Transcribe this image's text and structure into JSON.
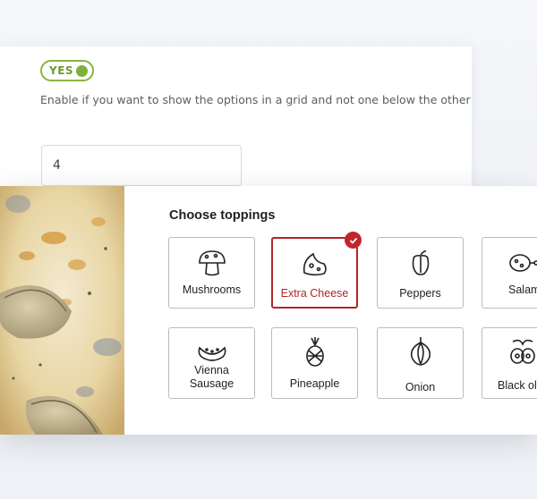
{
  "settings": {
    "toggle_label": "YES",
    "help_text": "Enable if you want to show the options in a grid and not one below the other",
    "columns_value": "4"
  },
  "toppings": {
    "title": "Choose toppings",
    "items": [
      {
        "label": "Mushrooms",
        "icon": "mushroom-icon",
        "selected": false
      },
      {
        "label": "Extra Cheese",
        "icon": "cheese-icon",
        "selected": true
      },
      {
        "label": "Peppers",
        "icon": "pepper-icon",
        "selected": false
      },
      {
        "label": "Salami",
        "icon": "salami-icon",
        "selected": false
      },
      {
        "label_line1": "Vienna",
        "label_line2": "Sausage",
        "icon": "sausage-icon",
        "selected": false
      },
      {
        "label": "Pineapple",
        "icon": "pineapple-icon",
        "selected": false
      },
      {
        "label": "Onion",
        "icon": "onion-icon",
        "selected": false
      },
      {
        "label": "Black olives",
        "icon": "olives-icon",
        "selected": false
      }
    ]
  },
  "colors": {
    "toggle_green": "#7fb03a",
    "selected_red": "#b2242a"
  }
}
